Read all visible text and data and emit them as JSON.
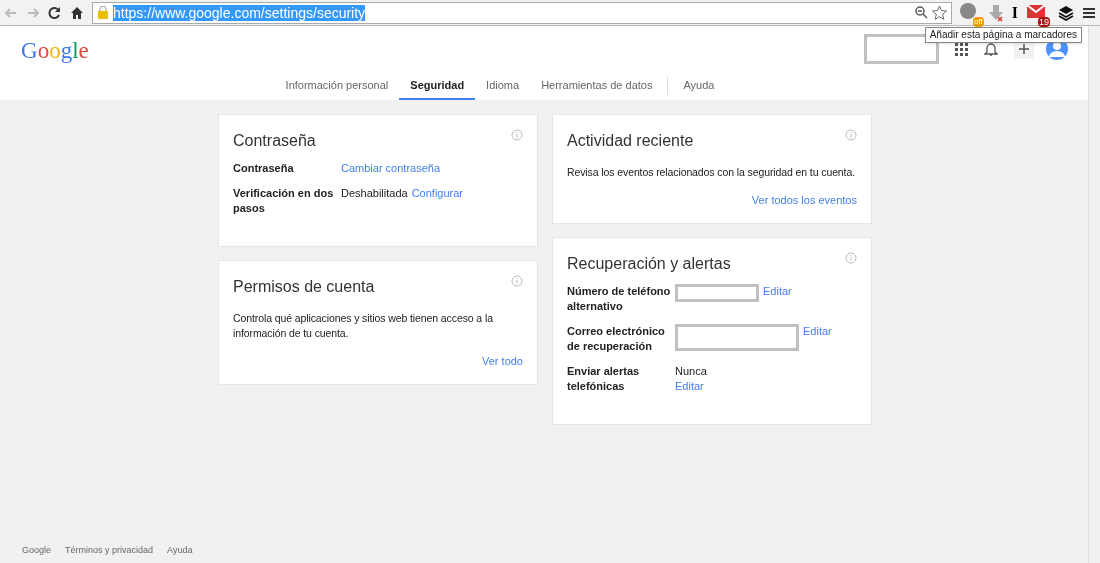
{
  "browser": {
    "url": "https://www.google.com/settings/security",
    "url_selected": true,
    "extensions": [
      {
        "kind": "owl",
        "badge": "off"
      },
      {
        "kind": "download"
      },
      {
        "kind": "letter",
        "text": "I"
      },
      {
        "kind": "mail",
        "badge": "19"
      },
      {
        "kind": "layers"
      }
    ],
    "tooltip": "Añadir esta página a marcadores"
  },
  "header": {
    "logo": "Google",
    "tabs": [
      {
        "label": "Información personal",
        "selected": false
      },
      {
        "label": "Seguridad",
        "selected": true
      },
      {
        "label": "Idioma",
        "selected": false
      },
      {
        "label": "Herramientas de datos",
        "selected": false
      },
      {
        "label": "Ayuda",
        "selected": false,
        "separated": true
      }
    ]
  },
  "columns": [
    [
      {
        "title": "Contraseña",
        "rows": [
          {
            "label": "Contraseña",
            "values": [
              {
                "kind": "link",
                "text": "Cambiar contraseña"
              }
            ]
          },
          {
            "label": "Verificación en dos pasos",
            "values": [
              {
                "kind": "text",
                "text": "Deshabilitada"
              },
              {
                "kind": "link",
                "text": "Configurar"
              }
            ]
          }
        ]
      },
      {
        "title": "Permisos de cuenta",
        "description": "Controla qué aplicaciones y sitios web tienen acceso a la información de tu cuenta.",
        "footer_link": "Ver todo"
      }
    ],
    [
      {
        "title": "Actividad reciente",
        "description": "Revisa los eventos relacionados con la seguridad en tu cuenta.",
        "footer_link": "Ver todos los eventos"
      },
      {
        "title": "Recuperación y alertas",
        "rows": [
          {
            "label": "Número de teléfono alternativo",
            "values": [
              {
                "kind": "redacted"
              },
              {
                "kind": "link",
                "text": "Editar"
              }
            ]
          },
          {
            "label": "Correo electrónico de recuperación",
            "values": [
              {
                "kind": "redactedwide"
              },
              {
                "kind": "link",
                "text": "Editar"
              }
            ]
          },
          {
            "label": "Enviar alertas telefónicas",
            "stacked": true,
            "values": [
              {
                "kind": "text",
                "text": "Nunca"
              },
              {
                "kind": "link",
                "text": "Editar"
              }
            ]
          }
        ]
      }
    ]
  ],
  "footer": [
    "Google",
    "Términos y privacidad",
    "Ayuda"
  ]
}
